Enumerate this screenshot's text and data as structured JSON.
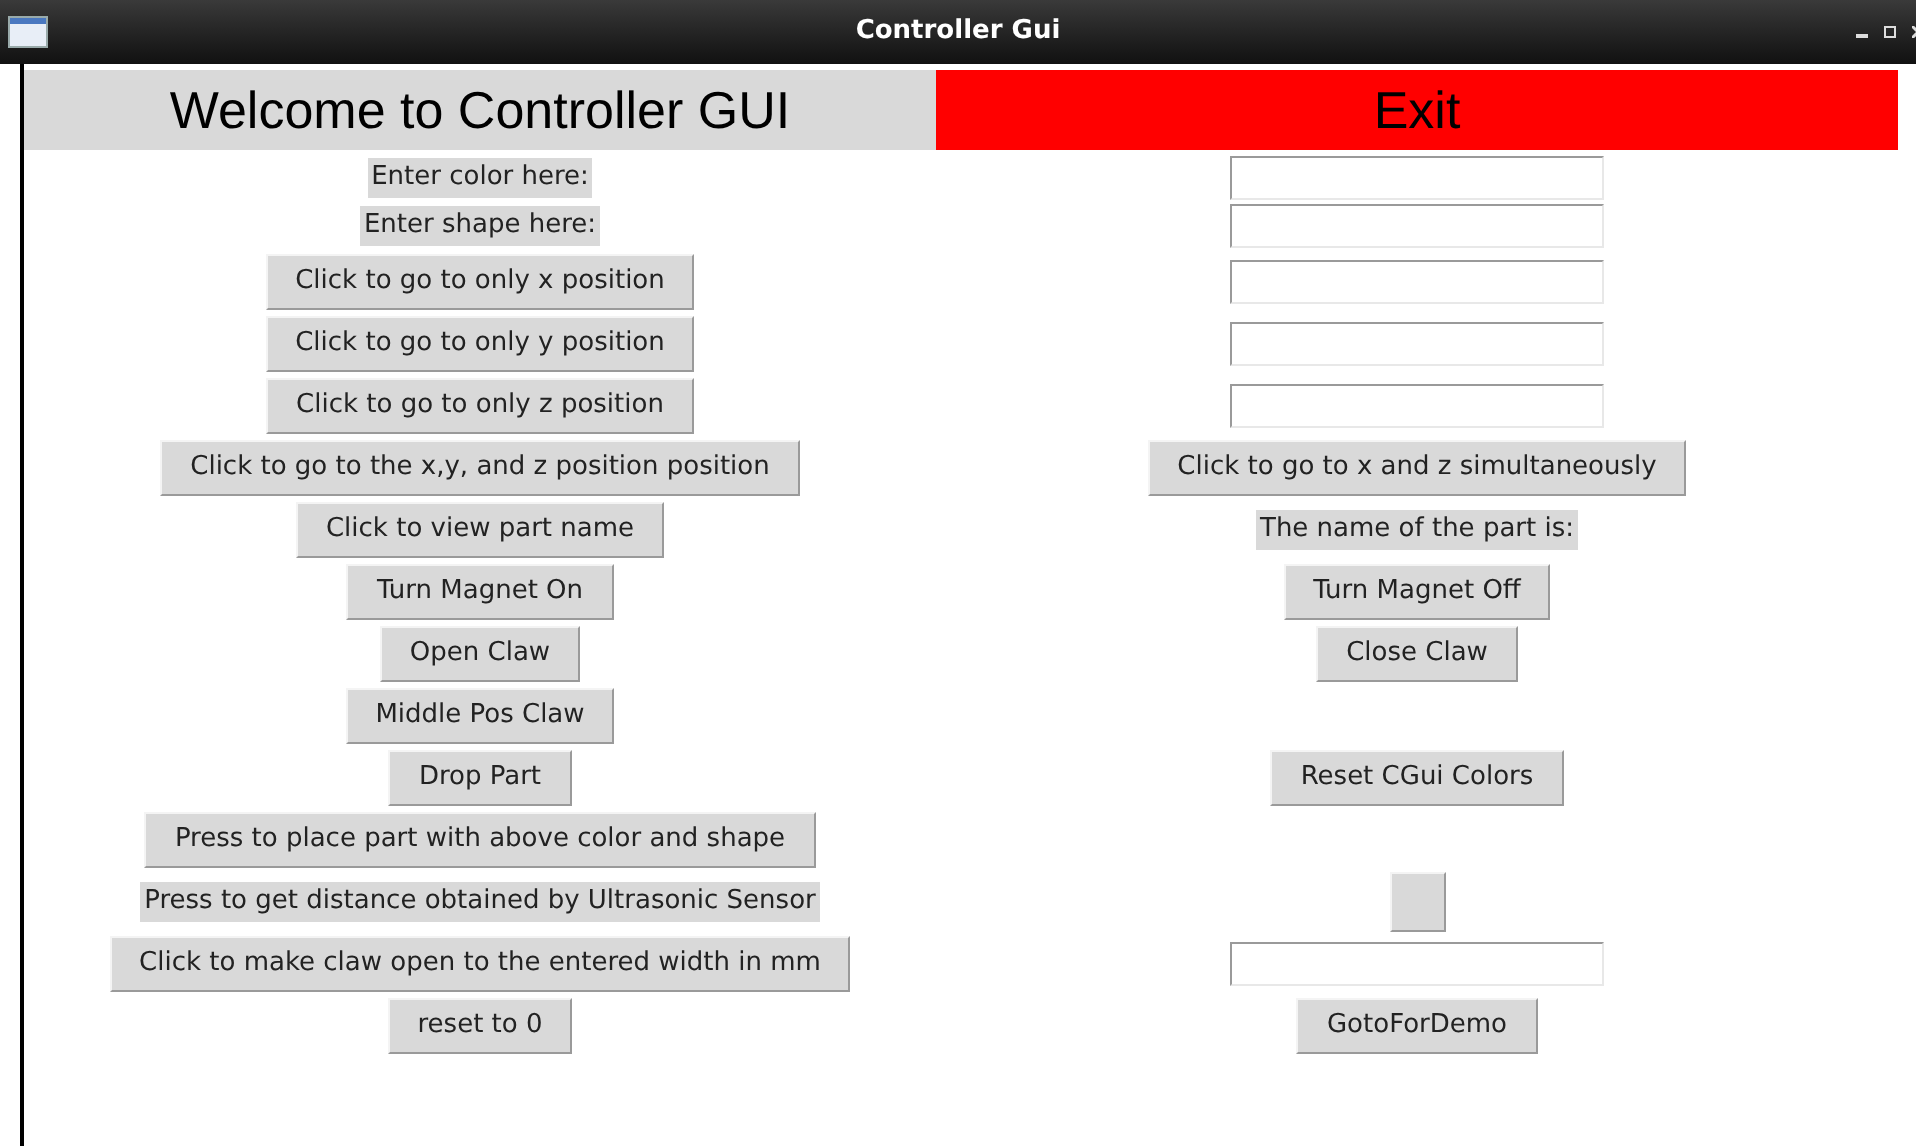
{
  "window": {
    "title": "Controller Gui"
  },
  "header": {
    "label": "Welcome to Controller GUI",
    "exit_button": "Exit"
  },
  "rows": [
    {
      "left": {
        "kind": "label",
        "text": "Enter color here:"
      },
      "right": {
        "kind": "entry"
      }
    },
    {
      "left": {
        "kind": "label",
        "text": "Enter shape here:"
      },
      "right": {
        "kind": "entry"
      }
    },
    {
      "left": {
        "kind": "button",
        "text": "Click to go to only x position"
      },
      "right": {
        "kind": "entry"
      }
    },
    {
      "left": {
        "kind": "button",
        "text": "Click to go to only y position"
      },
      "right": {
        "kind": "entry"
      }
    },
    {
      "left": {
        "kind": "button",
        "text": "Click to go to only z position"
      },
      "right": {
        "kind": "entry"
      }
    },
    {
      "left": {
        "kind": "button",
        "text": "Click to go to the x,y, and z position position"
      },
      "right": {
        "kind": "button",
        "text": "Click to go to x and z simultaneously"
      }
    },
    {
      "left": {
        "kind": "button",
        "text": "Click to view part name"
      },
      "right": {
        "kind": "label",
        "text": "The name of the part is:"
      }
    },
    {
      "left": {
        "kind": "button",
        "text": "Turn Magnet On"
      },
      "right": {
        "kind": "button",
        "text": "Turn Magnet Off"
      }
    },
    {
      "left": {
        "kind": "button",
        "text": "Open Claw"
      },
      "right": {
        "kind": "button",
        "text": "Close Claw"
      }
    },
    {
      "left": {
        "kind": "button",
        "text": "Middle Pos Claw"
      }
    },
    {
      "left": {
        "kind": "button",
        "text": "Drop Part"
      },
      "right": {
        "kind": "button",
        "text": "Reset CGui Colors"
      }
    },
    {
      "left": {
        "kind": "button",
        "text": "Press to place part with above color and shape"
      }
    },
    {
      "left": {
        "kind": "label",
        "text": "Press to get distance obtained by Ultrasonic Sensor"
      },
      "right": {
        "kind": "blank_button"
      }
    },
    {
      "left": {
        "kind": "button",
        "text": "Click to make claw open to the entered width in mm"
      },
      "right": {
        "kind": "entry"
      }
    },
    {
      "left": {
        "kind": "button",
        "text": "reset to 0"
      },
      "right": {
        "kind": "button",
        "text": "GotoForDemo"
      }
    }
  ]
}
